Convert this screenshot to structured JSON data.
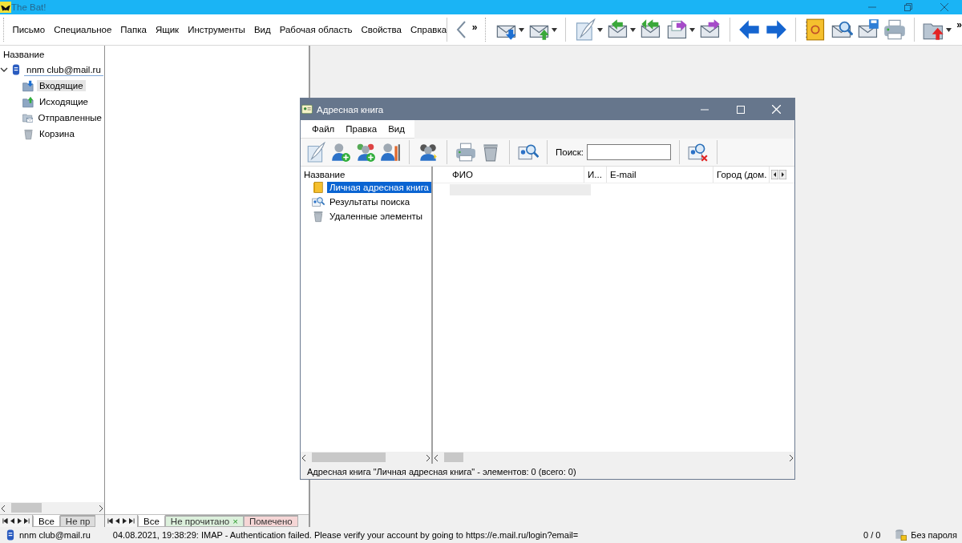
{
  "window": {
    "title": "The Bat!"
  },
  "menu": [
    "Письмо",
    "Специальное",
    "Папка",
    "Ящик",
    "Инструменты",
    "Вид",
    "Рабочая область",
    "Свойства",
    "Справка"
  ],
  "toolbar": {
    "more_left": "»",
    "more_right": "»",
    "groups": [
      [
        {
          "dropdown": true
        },
        {
          "dropdown": true
        }
      ],
      [
        {
          "dropdown": true
        },
        {
          "dropdown": true
        },
        {
          "dropdown": false
        },
        {
          "dropdown": true
        },
        {
          "dropdown": false
        }
      ],
      [
        {
          "dropdown": false
        },
        {
          "dropdown": false
        }
      ],
      [
        {
          "dropdown": false
        },
        {
          "dropdown": false
        },
        {
          "dropdown": false
        },
        {
          "dropdown": false
        }
      ],
      [
        {
          "dropdown": true
        }
      ]
    ]
  },
  "folder_tree": {
    "header": "Название",
    "items": [
      {
        "label": "nnm club@mail.ru",
        "expanded": true,
        "selected": false,
        "children": [
          {
            "label": "Входящие",
            "selected": true
          },
          {
            "label": "Исходящие",
            "selected": false
          },
          {
            "label": "Отправленные",
            "selected": false
          },
          {
            "label": "Корзина",
            "selected": false
          }
        ]
      }
    ]
  },
  "folder_tabs": [
    {
      "label": "Все",
      "selected": true
    },
    {
      "label": "Не пр",
      "selected": false
    }
  ],
  "message_tabs": [
    {
      "label": "Все",
      "selected": true
    },
    {
      "label": "Не прочитано",
      "selected": false,
      "color": "#dcf0dc",
      "close": "×"
    },
    {
      "label": "Помечено",
      "selected": false,
      "color": "#f6d6d6"
    }
  ],
  "status_bar": {
    "account": "nnm club@mail.ru",
    "message": "04.08.2021, 19:38:29: IMAP  - Authentication failed. Please verify your account by going to https://e.mail.ru/login?email=",
    "counter": "0 / 0",
    "security": "Без пароля"
  },
  "address_book": {
    "title": "Адресная книга",
    "menu": [
      "Файл",
      "Правка",
      "Вид"
    ],
    "search_label": "Поиск:",
    "tree": {
      "header": "Название",
      "items": [
        {
          "label": "Личная адресная книга",
          "selected": true
        },
        {
          "label": "Результаты поиска",
          "selected": false
        },
        {
          "label": "Удаленные элементы",
          "selected": false
        }
      ]
    },
    "columns": [
      "ФИО",
      "И...",
      "E-mail",
      "Город (дом."
    ],
    "status": "Адресная книга \"Личная адресная книга\" - элементов: 0 (всего: 0)"
  }
}
